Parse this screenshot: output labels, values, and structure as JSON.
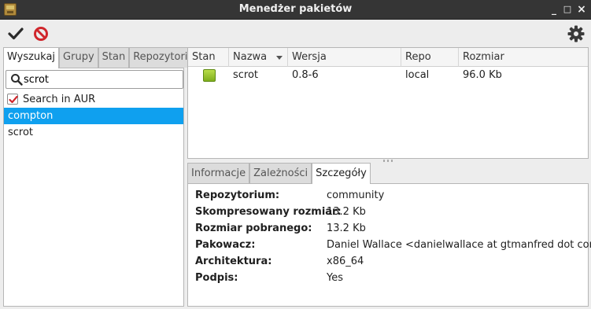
{
  "window": {
    "title": "Menedżer pakietów",
    "controls": [
      "_",
      "□",
      "×"
    ]
  },
  "toolbar": {
    "apply": "check-icon",
    "cancel": "cancel-icon",
    "settings": "gear-icon"
  },
  "left": {
    "tabs": [
      "Wyszukaj",
      "Grupy",
      "Stan",
      "Repozytoria"
    ],
    "active_tab": "Wyszukaj",
    "search": {
      "value": "scrot",
      "placeholder": ""
    },
    "aur_label": "Search in AUR",
    "aur_checked": true,
    "results": [
      {
        "name": "compton",
        "selected": true
      },
      {
        "name": "scrot",
        "selected": false
      }
    ]
  },
  "table": {
    "columns": [
      "Stan",
      "Nazwa",
      "Wersja",
      "Repo",
      "Rozmiar"
    ],
    "rows": [
      {
        "state": "installed",
        "name": "scrot",
        "version": "0.8-6",
        "repo": "local",
        "size": "96.0 Kb"
      }
    ]
  },
  "details": {
    "tabs": [
      "Informacje",
      "Zależności",
      "Szczegóły"
    ],
    "active_tab": "Szczegóły",
    "rows": [
      {
        "label": "Repozytorium:",
        "value": "community"
      },
      {
        "label": "Skompresowany rozmiar:",
        "value": "13.2 Kb"
      },
      {
        "label": "Rozmiar pobranego:",
        "value": "13.2 Kb"
      },
      {
        "label": "Pakowacz:",
        "value": "Daniel Wallace <danielwallace at gtmanfred dot com>"
      },
      {
        "label": "Architektura:",
        "value": "x86_64"
      },
      {
        "label": "Podpis:",
        "value": "Yes"
      }
    ]
  },
  "colors": {
    "selection": "#0fa0ef",
    "titlebar": "#353535",
    "installed": "#8cbf26"
  }
}
